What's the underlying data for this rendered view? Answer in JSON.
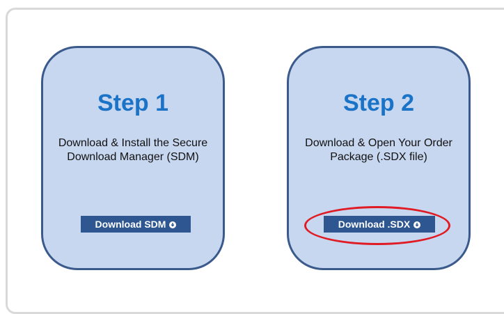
{
  "steps": [
    {
      "title": "Step 1",
      "description": "Download & Install the Secure Download Manager (SDM)",
      "button_label": "Download SDM",
      "button_icon": "download-circle-icon"
    },
    {
      "title": "Step 2",
      "description": "Download & Open Your Order Package (.SDX file)",
      "button_label": "Download .SDX",
      "button_icon": "download-circle-icon"
    }
  ],
  "colors": {
    "card_fill": "#c8d7f0",
    "card_border": "#3b5a8c",
    "title": "#1a73c7",
    "button": "#2e5691",
    "highlight": "#e01b24"
  }
}
